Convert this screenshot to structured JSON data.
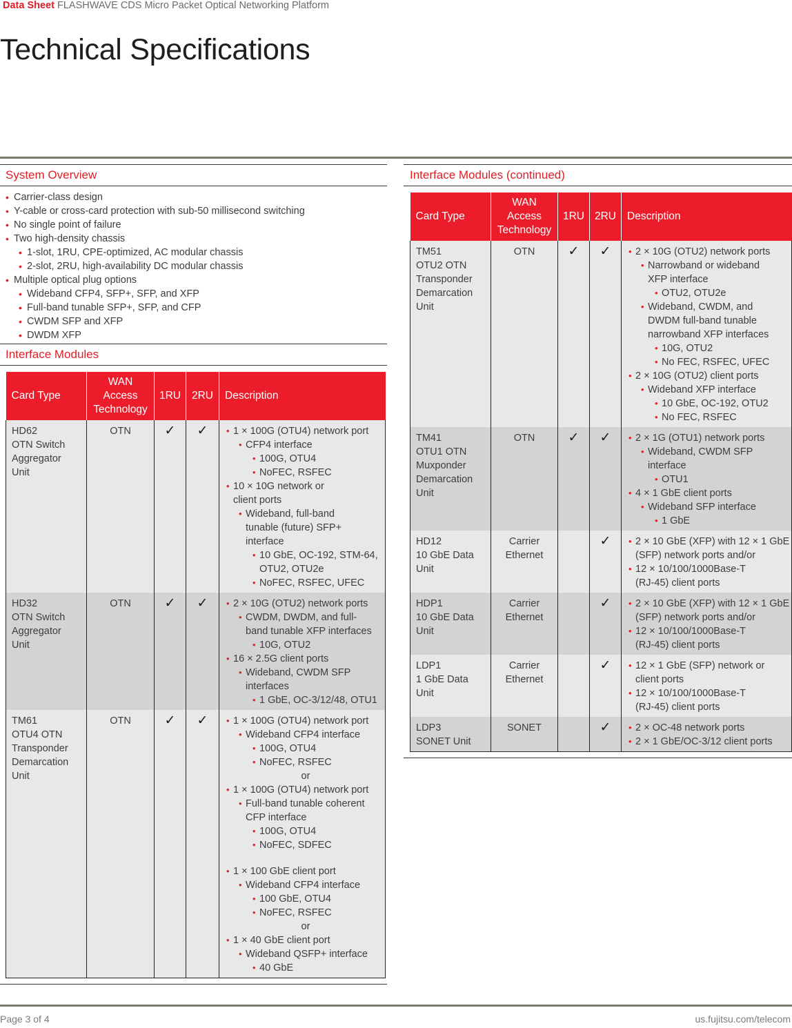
{
  "header": {
    "doc_type": "Data Sheet",
    "product": "FLASHWAVE CDS Micro Packet Optical Networking Platform",
    "title": "Technical Specifications"
  },
  "colors": {
    "accent": "#e01e28",
    "header_bg": "#ec1c2a",
    "row_light": "#e8e8e8",
    "row_dark": "#d3d3d3",
    "rule": "#7b786f"
  },
  "system_overview": {
    "title": "System Overview",
    "items": [
      {
        "level": 0,
        "text": "Carrier-class design"
      },
      {
        "level": 0,
        "text": "Y-cable or cross-card protection with sub-50 millisecond switching"
      },
      {
        "level": 0,
        "text": "No single point of failure"
      },
      {
        "level": 0,
        "text": "Two high-density chassis"
      },
      {
        "level": 1,
        "text": "1-slot, 1RU, CPE-optimized, AC modular chassis"
      },
      {
        "level": 1,
        "text": "2-slot, 2RU, high-availability DC modular chassis"
      },
      {
        "level": 0,
        "text": "Multiple optical plug options"
      },
      {
        "level": 1,
        "text": "Wideband CFP4, SFP+, SFP, and XFP"
      },
      {
        "level": 1,
        "text": "Full-band tunable SFP+, SFP, and CFP"
      },
      {
        "level": 1,
        "text": "CWDM SFP and XFP"
      },
      {
        "level": 1,
        "text": "DWDM XFP"
      }
    ]
  },
  "table_headers": {
    "card_type": "Card Type",
    "wan": [
      "WAN",
      "Access",
      "Technology"
    ],
    "ru1": "1RU",
    "ru2": "2RU",
    "description": "Description"
  },
  "check_glyph": "✓",
  "interface_modules": {
    "title": "Interface Modules",
    "rows": [
      {
        "card": [
          "HD62",
          "OTN Switch",
          "Aggregator",
          "Unit"
        ],
        "tech": [
          "OTN"
        ],
        "ru1": true,
        "ru2": true,
        "desc": [
          {
            "level": 0,
            "text": "1 × 100G (OTU4) network port"
          },
          {
            "level": 1,
            "text": "CFP4 interface"
          },
          {
            "level": 2,
            "text": "100G, OTU4"
          },
          {
            "level": 2,
            "text": "NoFEC, RSFEC"
          },
          {
            "level": 0,
            "text": "10 × 10G network or"
          },
          {
            "level": 0,
            "cont": true,
            "text": "client ports"
          },
          {
            "level": 1,
            "text": "Wideband, full-band"
          },
          {
            "level": 1,
            "cont": true,
            "text": "tunable (future) SFP+"
          },
          {
            "level": 1,
            "cont": true,
            "text": "interface"
          },
          {
            "level": 2,
            "text": "10 GbE, OC-192, STM-64,"
          },
          {
            "level": 2,
            "cont": true,
            "text": "OTU2, OTU2e"
          },
          {
            "level": 2,
            "text": "NoFEC, RSFEC, UFEC"
          }
        ]
      },
      {
        "card": [
          "HD32",
          "OTN Switch",
          "Aggregator",
          "Unit"
        ],
        "tech": [
          "OTN"
        ],
        "ru1": true,
        "ru2": true,
        "desc": [
          {
            "level": 0,
            "text": "2 × 10G (OTU2) network ports"
          },
          {
            "level": 1,
            "text": "CWDM, DWDM, and full-"
          },
          {
            "level": 1,
            "cont": true,
            "text": "band tunable XFP interfaces"
          },
          {
            "level": 2,
            "text": "10G, OTU2"
          },
          {
            "level": 0,
            "text": "16 × 2.5G client ports"
          },
          {
            "level": 1,
            "text": "Wideband, CWDM SFP"
          },
          {
            "level": 1,
            "cont": true,
            "text": "interfaces"
          },
          {
            "level": 2,
            "text": "1 GbE, OC-3/12/48, OTU1"
          }
        ]
      },
      {
        "card": [
          "TM61",
          "OTU4 OTN",
          "Transponder",
          "Demarcation",
          "Unit"
        ],
        "tech": [
          "OTN"
        ],
        "ru1": true,
        "ru2": true,
        "desc": [
          {
            "level": 0,
            "text": "1 × 100G (OTU4) network port"
          },
          {
            "level": 1,
            "text": "Wideband CFP4 interface"
          },
          {
            "level": 2,
            "text": "100G, OTU4"
          },
          {
            "level": 2,
            "text": "NoFEC, RSFEC"
          },
          {
            "or": true,
            "text": "or"
          },
          {
            "level": 0,
            "text": "1 × 100G (OTU4) network port"
          },
          {
            "level": 1,
            "text": "Full-band tunable coherent"
          },
          {
            "level": 1,
            "cont": true,
            "text": "CFP interface"
          },
          {
            "level": 2,
            "text": "100G, OTU4"
          },
          {
            "level": 2,
            "text": "NoFEC, SDFEC"
          },
          {
            "gap": true,
            "text": ""
          },
          {
            "level": 0,
            "text": "1 × 100 GbE client port"
          },
          {
            "level": 1,
            "text": "Wideband CFP4 interface"
          },
          {
            "level": 2,
            "text": "100 GbE, OTU4"
          },
          {
            "level": 2,
            "text": "NoFEC, RSFEC"
          },
          {
            "or": true,
            "text": "or"
          },
          {
            "level": 0,
            "text": "1 × 40 GbE client port"
          },
          {
            "level": 1,
            "text": "Wideband QSFP+ interface"
          },
          {
            "level": 2,
            "text": "40 GbE"
          }
        ]
      }
    ]
  },
  "interface_modules_continued": {
    "title": "Interface Modules (continued)",
    "rows": [
      {
        "card": [
          "TM51",
          "OTU2 OTN",
          "Transponder",
          "Demarcation",
          "Unit"
        ],
        "tech": [
          "OTN"
        ],
        "ru1": true,
        "ru2": true,
        "desc": [
          {
            "level": 0,
            "text": "2 × 10G (OTU2) network ports"
          },
          {
            "level": 1,
            "text": "Narrowband or wideband"
          },
          {
            "level": 1,
            "cont": true,
            "text": "XFP interface"
          },
          {
            "level": 2,
            "text": "OTU2, OTU2e"
          },
          {
            "level": 1,
            "text": "Wideband, CWDM, and"
          },
          {
            "level": 1,
            "cont": true,
            "text": "DWDM full-band tunable"
          },
          {
            "level": 1,
            "cont": true,
            "text": "narrowband XFP interfaces"
          },
          {
            "level": 2,
            "text": "10G, OTU2"
          },
          {
            "level": 2,
            "text": "No FEC, RSFEC, UFEC"
          },
          {
            "level": 0,
            "text": "2 × 10G (OTU2) client ports"
          },
          {
            "level": 1,
            "text": "Wideband XFP interface"
          },
          {
            "level": 2,
            "text": "10 GbE, OC-192, OTU2"
          },
          {
            "level": 2,
            "text": "No FEC, RSFEC"
          }
        ]
      },
      {
        "card": [
          "TM41",
          "OTU1 OTN",
          "Muxponder",
          "Demarcation",
          "Unit"
        ],
        "tech": [
          "OTN"
        ],
        "ru1": true,
        "ru2": true,
        "desc": [
          {
            "level": 0,
            "text": "2 × 1G (OTU1) network ports"
          },
          {
            "level": 1,
            "text": "Wideband, CWDM SFP"
          },
          {
            "level": 1,
            "cont": true,
            "text": "interface"
          },
          {
            "level": 2,
            "text": "OTU1"
          },
          {
            "level": 0,
            "text": "4 × 1 GbE client ports"
          },
          {
            "level": 1,
            "text": "Wideband SFP interface"
          },
          {
            "level": 2,
            "text": "1 GbE"
          }
        ]
      },
      {
        "card": [
          "HD12",
          "10 GbE Data",
          "Unit"
        ],
        "tech": [
          "Carrier",
          "Ethernet"
        ],
        "ru1": false,
        "ru2": true,
        "desc": [
          {
            "level": 0,
            "text": "2 × 10 GbE (XFP) with 12 × 1 GbE"
          },
          {
            "level": 0,
            "cont": true,
            "text": "(SFP) network ports and/or"
          },
          {
            "level": 0,
            "text": "12 × 10/100/1000Base-T"
          },
          {
            "level": 0,
            "cont": true,
            "text": "(RJ-45) client ports"
          }
        ]
      },
      {
        "card": [
          "HDP1",
          "10 GbE Data",
          "Unit"
        ],
        "tech": [
          "Carrier",
          "Ethernet"
        ],
        "ru1": false,
        "ru2": true,
        "desc": [
          {
            "level": 0,
            "text": "2 × 10 GbE (XFP) with 12 × 1 GbE"
          },
          {
            "level": 0,
            "cont": true,
            "text": "(SFP) network ports and/or"
          },
          {
            "level": 0,
            "text": "12 × 10/100/1000Base-T"
          },
          {
            "level": 0,
            "cont": true,
            "text": "(RJ-45) client ports"
          }
        ]
      },
      {
        "card": [
          "LDP1",
          "1 GbE Data",
          "Unit"
        ],
        "tech": [
          "Carrier",
          "Ethernet"
        ],
        "ru1": false,
        "ru2": true,
        "desc": [
          {
            "level": 0,
            "text": "12 × 1 GbE (SFP) network or"
          },
          {
            "level": 0,
            "cont": true,
            "text": "client ports"
          },
          {
            "level": 0,
            "text": "12 × 10/100/1000Base-T"
          },
          {
            "level": 0,
            "cont": true,
            "text": "(RJ-45) client ports"
          }
        ]
      },
      {
        "card": [
          "LDP3",
          "SONET Unit"
        ],
        "tech": [
          "SONET"
        ],
        "ru1": false,
        "ru2": true,
        "desc": [
          {
            "level": 0,
            "text": "2 × OC-48 network ports"
          },
          {
            "level": 0,
            "text": "2 × 1 GbE/OC-3/12 client ports"
          }
        ]
      }
    ]
  },
  "footer": {
    "page": "Page 3 of 4",
    "url": "us.fujitsu.com/telecom"
  }
}
